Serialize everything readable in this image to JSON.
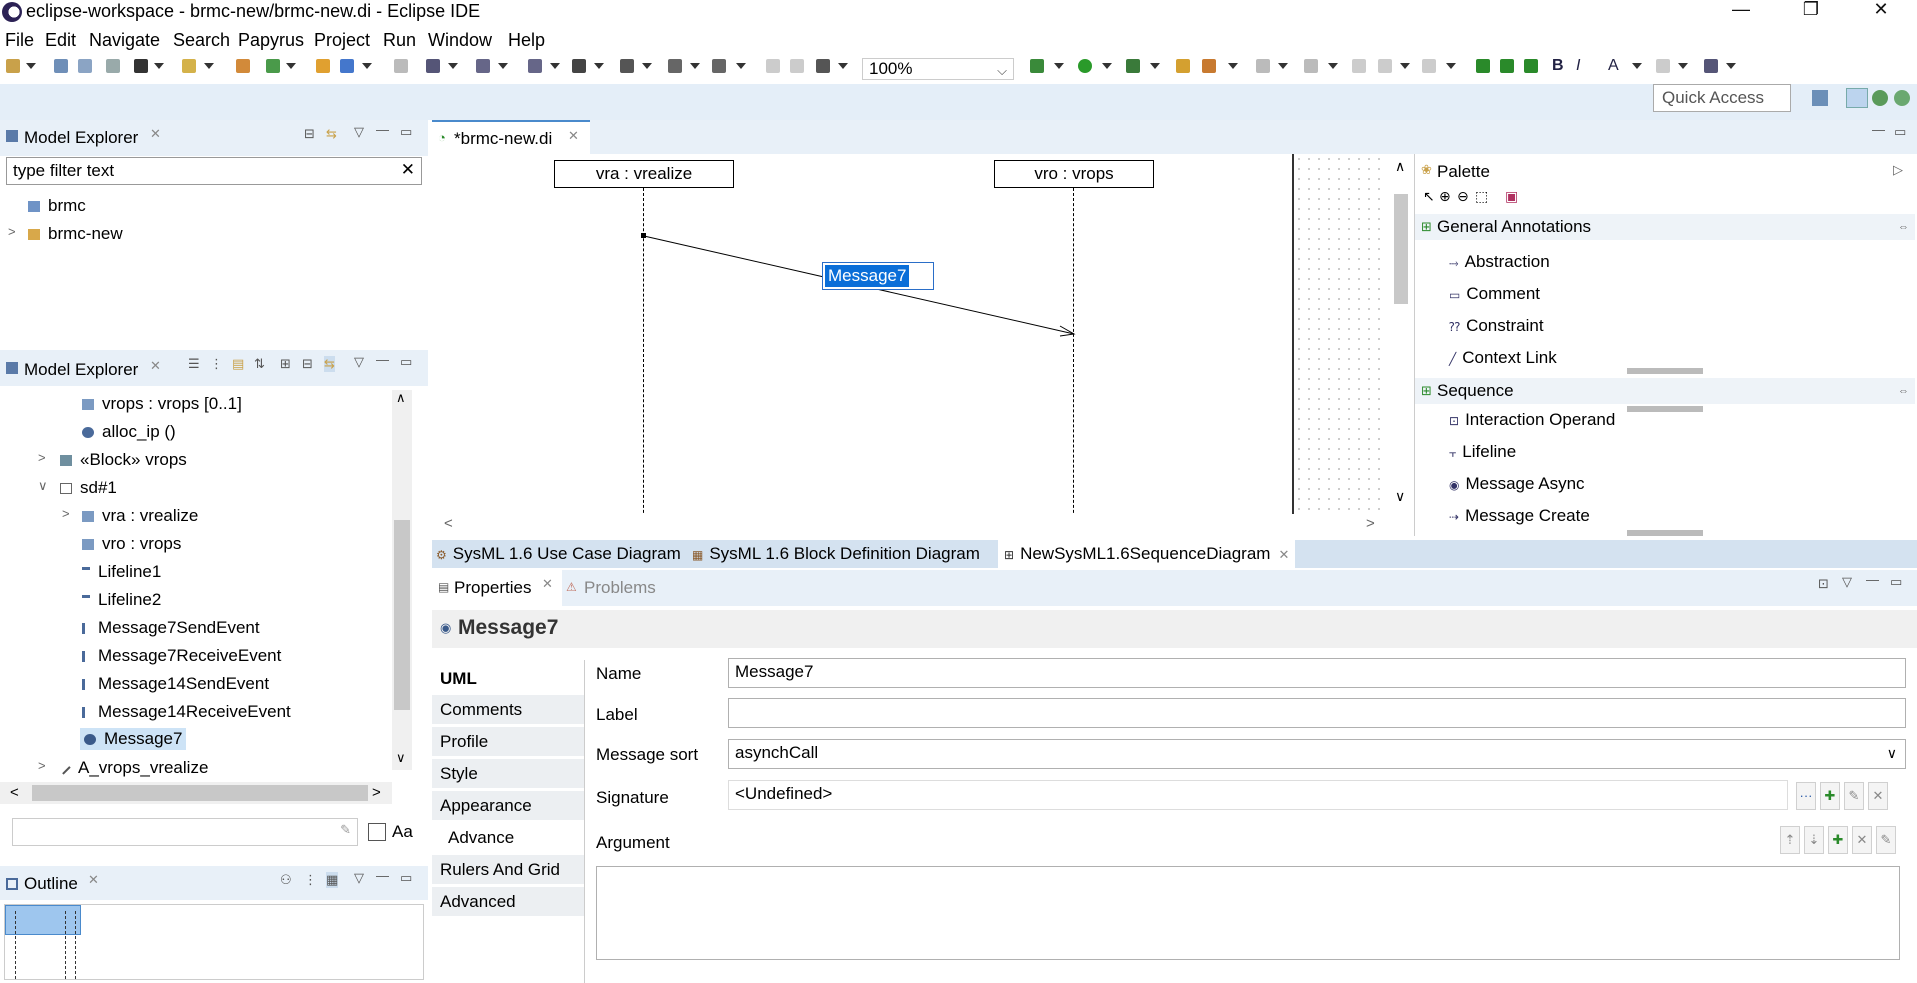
{
  "window": {
    "title": "eclipse-workspace - brmc-new/brmc-new.di - Eclipse IDE",
    "controls": [
      "—",
      "❐",
      "✕"
    ]
  },
  "menu": [
    "File",
    "Edit",
    "Navigate",
    "Search",
    "Papyrus",
    "Project",
    "Run",
    "Window",
    "Help"
  ],
  "toolbar": {
    "zoom": "100%"
  },
  "quick_access": {
    "placeholder": "Quick Access"
  },
  "model_explorer_top": {
    "title": "Model Explorer",
    "filter_placeholder": "type filter text",
    "items": [
      "brmc",
      "brmc-new"
    ]
  },
  "model_explorer_bottom": {
    "title": "Model Explorer",
    "items": [
      "vrops : vrops [0..1]",
      "alloc_ip ()",
      "«Block» vrops",
      "sd#1",
      "vra : vrealize",
      "vro : vrops",
      "Lifeline1",
      "Lifeline2",
      "Message7SendEvent",
      "Message7ReceiveEvent",
      "Message14SendEvent",
      "Message14ReceiveEvent",
      "Message7",
      "A_vrops_vrealize"
    ],
    "case_label": "Aa"
  },
  "outline": {
    "title": "Outline"
  },
  "editor": {
    "tab": "*brmc-new.di",
    "lifelines": [
      "vra : vrealize",
      "vro : vrops"
    ],
    "message_label": "Message7"
  },
  "palette": {
    "title": "Palette",
    "drawers": [
      {
        "name": "General Annotations",
        "items": [
          "Abstraction",
          "Comment",
          "Constraint",
          "Context Link"
        ]
      },
      {
        "name": "Sequence",
        "items": [
          "Interaction Operand",
          "Lifeline",
          "Message Async",
          "Message Create"
        ]
      }
    ]
  },
  "diagram_tabs": [
    "SysML 1.6 Use Case Diagram",
    "SysML 1.6 Block Definition Diagram",
    "NewSysML1.6SequenceDiagram"
  ],
  "properties": {
    "tabs_header": [
      "Properties",
      "Problems"
    ],
    "heading": "Message7",
    "side_tabs": [
      "UML",
      "Comments",
      "Profile",
      "Style",
      "Appearance",
      "Advance",
      "Rulers And Grid",
      "Advanced"
    ],
    "fields": {
      "name_label": "Name",
      "name_value": "Message7",
      "label_label": "Label",
      "label_value": "",
      "sort_label": "Message sort",
      "sort_value": "asynchCall",
      "signature_label": "Signature",
      "signature_value": "<Undefined>",
      "argument_label": "Argument"
    }
  }
}
